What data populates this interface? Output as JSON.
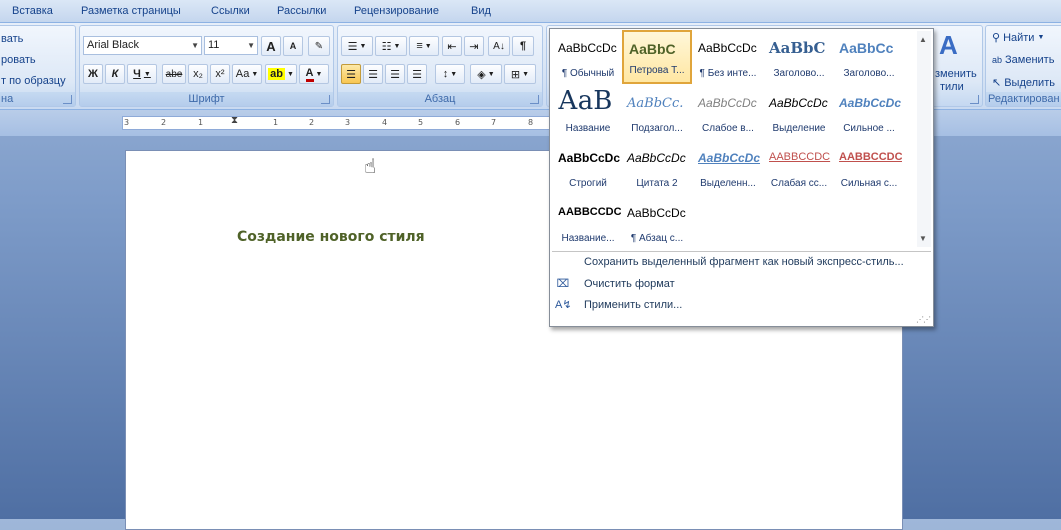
{
  "tabs": [
    "Вставка",
    "Разметка страницы",
    "Ссылки",
    "Рассылки",
    "Рецензирование",
    "Вид"
  ],
  "clipboard": {
    "items": [
      "вать",
      "ровать",
      "т по образцу"
    ],
    "label": "на"
  },
  "font_group": {
    "font_name": "Arial Black",
    "font_size": "11",
    "label": "Шрифт",
    "bold": "Ж",
    "italic": "К",
    "underline": "Ч",
    "strike": "abe",
    "subscript": "x₂",
    "superscript": "x²",
    "change_case": "Аа",
    "grow": "A",
    "shrink": "A"
  },
  "paragraph_group": {
    "label": "Абзац"
  },
  "ruler_numbers": [
    "3",
    "2",
    "1",
    "1",
    "2",
    "3",
    "4",
    "5",
    "6",
    "7",
    "8"
  ],
  "document": {
    "text": "Создание нового стиля"
  },
  "styles_gallery": {
    "cells": [
      {
        "preview": "AaBbCcDc",
        "name": "¶ Обычный"
      },
      {
        "preview": "AaBbC",
        "name": "Петрова Т..."
      },
      {
        "preview": "AaBbCcDc",
        "name": "¶ Без инте..."
      },
      {
        "preview": "AaBbC",
        "name": "Заголово..."
      },
      {
        "preview": "AaBbCc",
        "name": "Заголово..."
      },
      {
        "preview": "АаВ",
        "name": "Название"
      },
      {
        "preview": "AaBbCc.",
        "name": "Подзагол..."
      },
      {
        "preview": "AaBbCcDc",
        "name": "Слабое в..."
      },
      {
        "preview": "AaBbCcDc",
        "name": "Выделение"
      },
      {
        "preview": "AaBbCcDc",
        "name": "Сильное ..."
      },
      {
        "preview": "AaBbCcDc",
        "name": "Строгий"
      },
      {
        "preview": "AaBbCcDc",
        "name": "Цитата 2"
      },
      {
        "preview": "AaBbCcDc",
        "name": "Выделенн..."
      },
      {
        "preview": "AABBCCDC",
        "name": "Слабая сс..."
      },
      {
        "preview": "AABBCCDC",
        "name": "Сильная с..."
      },
      {
        "preview": "AABBCCDC",
        "name": "Название..."
      },
      {
        "preview": "AaBbCcDc",
        "name": "¶ Абзац с..."
      }
    ],
    "menu": [
      {
        "icon": "save-style-icon",
        "label": "Сохранить выделенный фрагмент как новый экспресс-стиль..."
      },
      {
        "icon": "clear-format-icon",
        "label": "Очистить формат"
      },
      {
        "icon": "apply-styles-icon",
        "label": "Применить стили..."
      }
    ]
  },
  "styles_group": {
    "change_line1": "зменить",
    "change_line2": "тили"
  },
  "editing": {
    "find": "Найти",
    "replace": "Заменить",
    "select": "Выделить",
    "label": "Редактирован"
  },
  "colors": {
    "selected_border": "#e0a53b",
    "doc_text": "#4f6228",
    "ribbon_text": "#15428b"
  }
}
